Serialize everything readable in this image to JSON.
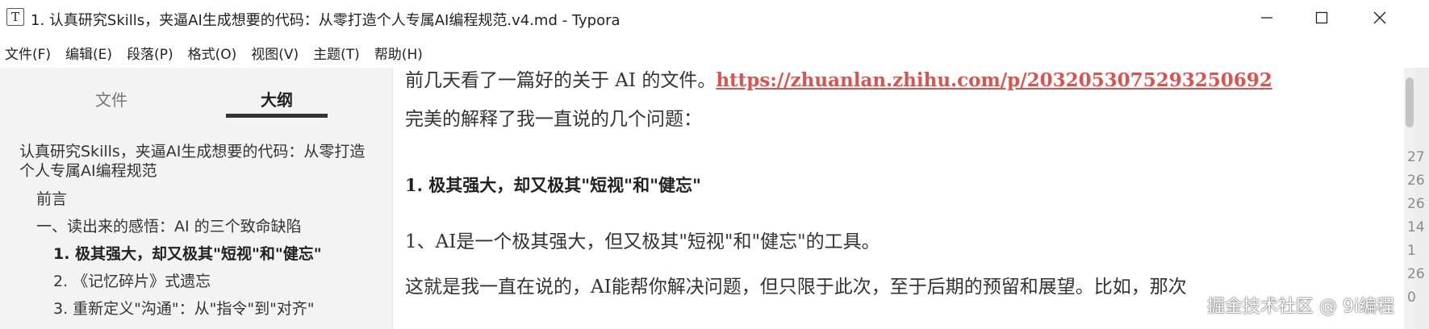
{
  "window": {
    "icon_letter": "T",
    "title": "1. 认真研究Skills，夹逼AI生成想要的代码：从零打造个人专属AI编程规范.v4.md - Typora"
  },
  "menu": [
    {
      "label": "文件(F)"
    },
    {
      "label": "编辑(E)"
    },
    {
      "label": "段落(P)"
    },
    {
      "label": "格式(O)"
    },
    {
      "label": "视图(V)"
    },
    {
      "label": "主题(T)"
    },
    {
      "label": "帮助(H)"
    }
  ],
  "sidebar": {
    "tabs": [
      {
        "label": "文件",
        "active": false
      },
      {
        "label": "大纲",
        "active": true
      }
    ],
    "outline": [
      {
        "label": "认真研究Skills，夹逼AI生成想要的代码：从零打造个人专属AI编程规范",
        "level": 1
      },
      {
        "label": "前言",
        "level": 2
      },
      {
        "label": "一、读出来的感悟：AI 的三个致命缺陷",
        "level": 2
      },
      {
        "label": "1. 极其强大，却又极其\"短视\"和\"健忘\"",
        "level": 3,
        "active": true
      },
      {
        "label": "2. 《记忆碎片》式遗忘",
        "level": 3
      },
      {
        "label": "3. 重新定义\"沟通\"：从\"指令\"到\"对齐\"",
        "level": 3
      }
    ]
  },
  "editor": {
    "p1_text": "前几天看了一篇好的关于 AI 的文件。",
    "p1_link": "https://zhuanlan.zhihu.com/p/2032053075293250692",
    "p2": "完美的解释了我一直说的几个问题：",
    "heading": "1. 极其强大，却又极其\"短视\"和\"健忘\"",
    "p3": "1、AI是一个极其强大，但又极其\"短视\"和\"健忘\"的工具。",
    "p4": "这就是我一直在说的，AI能帮你解决问题，但只限于此次，至于后期的预留和展望。比如，那次"
  },
  "edge_numbers": [
    "27",
    "26",
    "26",
    "14",
    "1",
    "26",
    "0"
  ],
  "watermark": "掘金技术社区 @ 9i编程",
  "colors": {
    "link": "#d9534f",
    "sidebar_bg": "#f3f3f3",
    "active_tab_underline": "#333333"
  },
  "icons": [
    "app-icon",
    "minimize-icon",
    "maximize-icon",
    "close-icon"
  ]
}
